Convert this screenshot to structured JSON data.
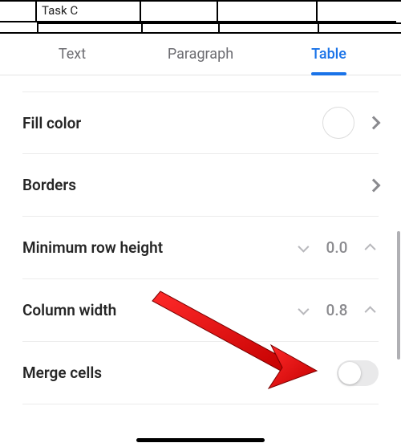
{
  "doc": {
    "cell_text": "Task C"
  },
  "tabs": {
    "t0": "Text",
    "t1": "Paragraph",
    "t2": "Table"
  },
  "rows": {
    "fill_color": {
      "label": "Fill color"
    },
    "borders": {
      "label": "Borders"
    },
    "min_row_h": {
      "label": "Minimum row height",
      "value": "0.0"
    },
    "col_width": {
      "label": "Column width",
      "value": "0.8"
    },
    "merge": {
      "label": "Merge cells"
    }
  }
}
